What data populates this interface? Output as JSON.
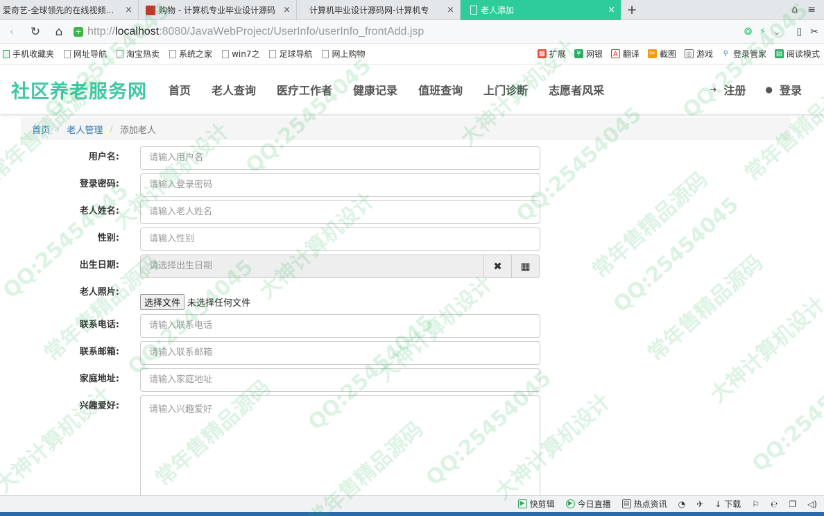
{
  "browser": {
    "tabs": [
      {
        "label": "爱奇艺-全球领先的在线视频网站",
        "favicon": "none-icon",
        "active": false
      },
      {
        "label": "购物 - 计算机专业毕业设计源码",
        "favicon": "shop-icon",
        "active": false
      },
      {
        "label": "计算机毕业设计源码网-计算机专",
        "favicon": "page-icon",
        "active": false
      },
      {
        "label": "老人添加",
        "favicon": "page-icon",
        "active": true
      }
    ],
    "tab_close": "×",
    "new_tab": "+",
    "url": {
      "scheme": "http://",
      "host": "localhost",
      "rest": ":8080/JavaWebProject/UserInfo/userInfo_frontAdd.jsp"
    },
    "bookmarks": [
      "手机收藏夹",
      "网址导航",
      "淘宝热卖",
      "系统之家",
      "win7之",
      "足球导航",
      "网上购物"
    ],
    "tools": [
      "扩展",
      "网银",
      "翻译",
      "截图",
      "游戏",
      "登录管家",
      "阅读模式"
    ],
    "status_items": [
      "快剪辑",
      "今日直播",
      "热点资讯",
      "下载"
    ],
    "accent_color": "#2ecc9a"
  },
  "site": {
    "brand": "社区养老服务网",
    "brand_color": "#3fc8a3",
    "menu": [
      "首页",
      "老人查询",
      "医疗工作者",
      "健康记录",
      "值班查询",
      "上门诊断",
      "志愿者风采"
    ],
    "register": "注册",
    "login": "登录"
  },
  "breadcrumb": {
    "home": "首页",
    "section": "老人管理",
    "current": "添加老人",
    "sep": "/"
  },
  "form": {
    "user_name": {
      "label": "用户名:",
      "placeholder": "请输入用户名"
    },
    "password": {
      "label": "登录密码:",
      "placeholder": "请输入登录密码"
    },
    "real_name": {
      "label": "老人姓名:",
      "placeholder": "请输入老人姓名"
    },
    "gender": {
      "label": "性别:",
      "placeholder": "请输入性别"
    },
    "birthday": {
      "label": "出生日期:",
      "placeholder": "请选择出生日期"
    },
    "photo": {
      "label": "老人照片:",
      "button": "选择文件",
      "status": "未选择任何文件"
    },
    "phone": {
      "label": "联系电话:",
      "placeholder": "请输入联系电话"
    },
    "email": {
      "label": "联系邮箱:",
      "placeholder": "请输入联系邮箱"
    },
    "address": {
      "label": "家庭地址:",
      "placeholder": "请输入家庭地址"
    },
    "hobby": {
      "label": "兴趣爱好:",
      "placeholder": "请输入兴趣爱好"
    }
  },
  "watermark": [
    "QQ:25454045",
    "大神计算机设计",
    "常年售精品源码"
  ]
}
